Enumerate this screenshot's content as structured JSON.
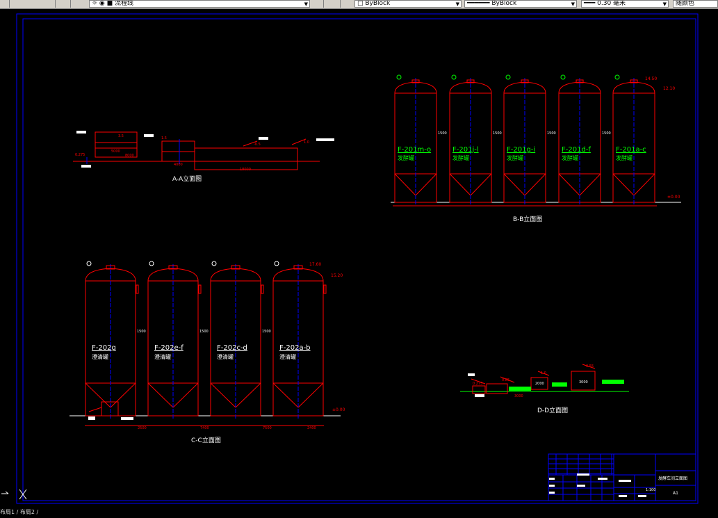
{
  "toolbar": {
    "layer_name": "流程线",
    "color_value": "ByBlock",
    "linetype_value": "ByBlock",
    "lineweight_value": "0.30 毫米",
    "plotstyle_value": "随颜色"
  },
  "colors": {
    "background": "#000000",
    "frame": "#0000ff",
    "drawing": "#ff0000",
    "annotation": "#00ff00",
    "label": "#ffffff"
  },
  "views": {
    "aa": {
      "caption": "A-A立面图",
      "dims": [
        "5000",
        "8000",
        "4000",
        "18000"
      ],
      "levels": [
        "0.275",
        "3.5",
        "1.5",
        "-0.5",
        "1.0"
      ]
    },
    "bb": {
      "caption": "B-B立面图",
      "level_bottom": "±0.00",
      "level_top": "14.50",
      "level_mid": "12.10",
      "spacing": "1500",
      "tanks": [
        {
          "id": "F-201m-o",
          "name": "发酵罐"
        },
        {
          "id": "F-201j-l",
          "name": "发酵罐"
        },
        {
          "id": "F-201g-i",
          "name": "发酵罐"
        },
        {
          "id": "F-201d-f",
          "name": "发酵罐"
        },
        {
          "id": "F-201a-c",
          "name": "发酵罐"
        }
      ]
    },
    "cc": {
      "caption": "C-C立面图",
      "level_bottom": "±0.00",
      "level_top": "17.60",
      "level_mid": "15.20",
      "spacing": "1500",
      "dims": [
        "2500",
        "7400",
        "7500",
        "2400"
      ],
      "tanks": [
        {
          "id": "F-202g",
          "name": "澄清罐"
        },
        {
          "id": "F-202e-f",
          "name": "澄清罐"
        },
        {
          "id": "F-202c-d",
          "name": "澄清罐"
        },
        {
          "id": "F-202a-b",
          "name": "澄清罐"
        }
      ]
    },
    "dd": {
      "caption": "D-D立面图",
      "dims": [
        "3000",
        "2000",
        "3000"
      ],
      "levels": [
        "0.275",
        "0.85",
        "1.0",
        "0.55"
      ]
    }
  },
  "title_block": {
    "drawing_title": "发酵车间立面图",
    "sheet_size": "A1",
    "scale": "1:100"
  },
  "statusline": "布局1 / 布局2 /"
}
